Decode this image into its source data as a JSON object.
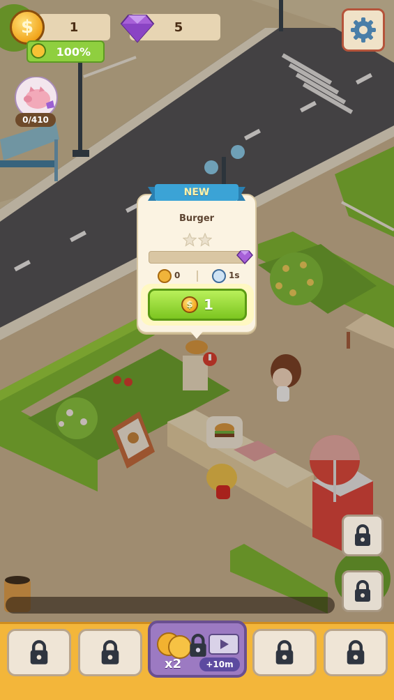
{
  "hud": {
    "coins": "1",
    "gems": "5",
    "progress_percent_label": "100%",
    "piggy_bank_count": "0/410"
  },
  "unlock_popup": {
    "ribbon": "NEW",
    "item_name": "Burger",
    "stars_filled": 0,
    "stars_total": 2,
    "progress_fraction": 0.0,
    "earning": "0",
    "cook_time": "1s",
    "price": "1"
  },
  "boost": {
    "multiplier": "x2",
    "duration": "+10m"
  },
  "icons": {
    "settings": "gear-icon",
    "coin": "coin-icon",
    "gem": "gem-icon",
    "lock": "lock-icon",
    "clock": "clock-icon",
    "piggy": "piggy-bank-icon",
    "video": "video-icon"
  },
  "colors": {
    "buy_button": "#7cc520",
    "tray": "#f3b63a",
    "ribbon": "#3ba3d6",
    "boost_panel": "#9c7ac2"
  }
}
